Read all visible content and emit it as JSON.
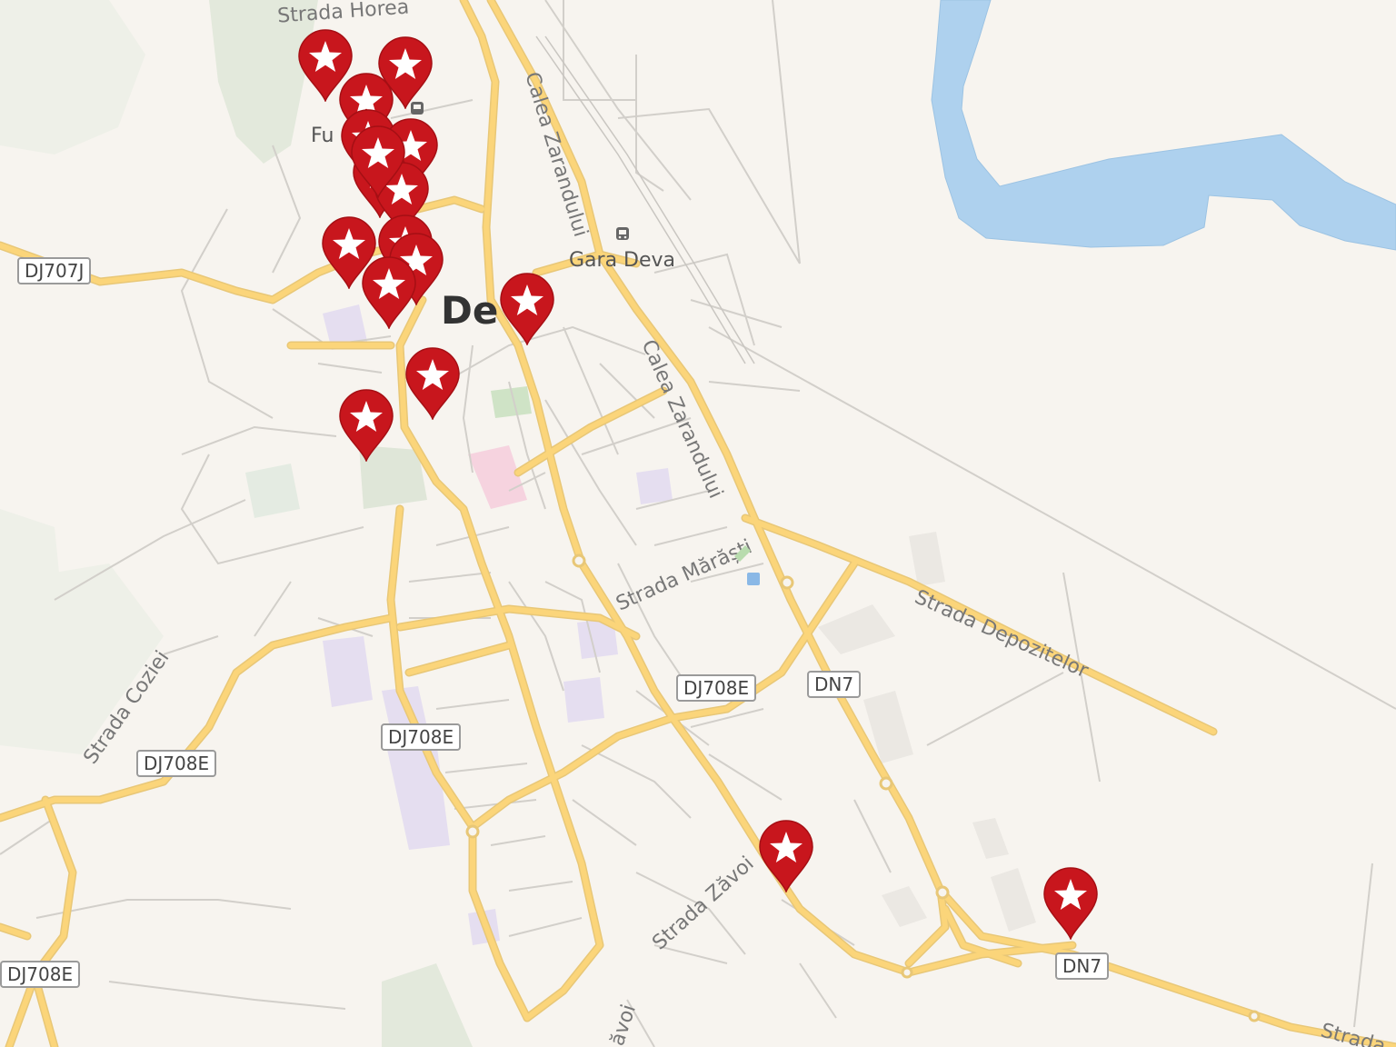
{
  "map": {
    "city_label": "Deva",
    "city_label_visible": "De",
    "poi_labels": {
      "station": "Gara Deva",
      "partial_fu": "Fu"
    },
    "street_labels": {
      "strada_horea": "Strada Horea",
      "calea_zarandului_1": "Calea Zarandului",
      "calea_zarandului_2": "Calea Zarandului",
      "strada_marasti": "Strada Mărăști",
      "strada_depozitelor": "Strada Depozitelor",
      "strada_coziei": "Strada Coziei",
      "strada_zavoi": "Strada Zăvoi",
      "strada_zavoi_partial": "ăvoi",
      "strada_partial_right": "Strada"
    },
    "road_shields": {
      "dj707j": "DJ707J",
      "dj708e_center": "DJ708E",
      "dj708e_mid": "DJ708E",
      "dj708e_left": "DJ708E",
      "dj708e_bottom_left": "DJ708E",
      "dn7_upper": "DN7",
      "dn7_lower": "DN7"
    },
    "marker_count": 17,
    "colors": {
      "background": "#f7f4ef",
      "water": "#aed1ee",
      "major_road": "#fbd57a",
      "minor_road": "#d2cfca",
      "marker": "#c8161d",
      "park": "#d9e3d2"
    },
    "icons": {
      "marker": "star-pin-icon",
      "station": "train-icon"
    }
  }
}
